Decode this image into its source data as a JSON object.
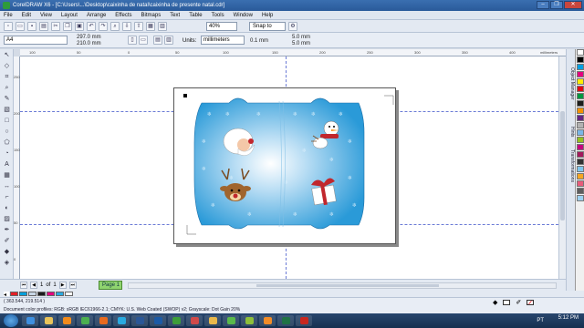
{
  "window": {
    "title": "CorelDRAW X6 - [C:\\Users\\...\\Desktop\\caixinha de natal\\caixinha de presente natal.cdr]",
    "controls": [
      "–",
      "❐",
      "✕"
    ]
  },
  "menu": [
    "File",
    "Edit",
    "View",
    "Layout",
    "Arrange",
    "Effects",
    "Bitmaps",
    "Text",
    "Table",
    "Tools",
    "Window",
    "Help"
  ],
  "toolbar": {
    "zoom": "40%",
    "snap_to": "Snap to"
  },
  "property_bar": {
    "paper": "A4",
    "width": "297.0 mm",
    "height": "210.0 mm",
    "units_label": "Units:",
    "units": "millimeters",
    "nudge": "0.1 mm",
    "dup_x": "5.0 mm",
    "dup_y": "5.0 mm"
  },
  "rulers": {
    "unit_label": "millimeters",
    "top_ticks": [
      "100",
      "50",
      "0",
      "50",
      "100",
      "150",
      "200",
      "250",
      "300",
      "350",
      "400"
    ],
    "left_ticks": [
      "250",
      "200",
      "150",
      "100",
      "50",
      "0"
    ]
  },
  "docker_tabs": [
    "Object Manager",
    "Hints",
    "Transformations"
  ],
  "palette_colors": [
    "#ffffff",
    "#000000",
    "#00a0e3",
    "#e4007f",
    "#ffed00",
    "#e30613",
    "#009640",
    "#1d1d1b",
    "#f39200",
    "#662483",
    "#b2b2b2",
    "#7ab6e6",
    "#95c11f",
    "#c6007e",
    "#a3195b",
    "#333333",
    "#7fc6ec",
    "#f6a623",
    "#e85c7a",
    "#5e5e5e",
    "#9ed2f2"
  ],
  "page_nav": {
    "current": "1",
    "of": "of",
    "total": "1",
    "tab": "Page 1"
  },
  "document_colors": [
    "#e41e26",
    "#00a0dc",
    "#c8d6e6",
    "#1c1c1c",
    "#e4007f",
    "#29aae1",
    "#ffffff"
  ],
  "status": {
    "coords": "( 363.544, 219.514 )",
    "profiles": "Document color profiles: RGB: sRGB IEC61966-2.1; CMYK: U.S. Web Coated (SWOP) v2; Grayscale: Dot Gain 20%",
    "fill_label": "None"
  },
  "taskbar": {
    "lang": "PT",
    "time": "5:12 PM",
    "apps": [
      {
        "name": "ie",
        "color": "#3d8fe0"
      },
      {
        "name": "explorer",
        "color": "#e8c35a"
      },
      {
        "name": "media",
        "color": "#f08a1c"
      },
      {
        "name": "chrome",
        "color": "#4caf50"
      },
      {
        "name": "firefox",
        "color": "#e86a1f"
      },
      {
        "name": "skype",
        "color": "#29aae1"
      },
      {
        "name": "word",
        "color": "#2b5797"
      },
      {
        "name": "photoshop",
        "color": "#1c5aa6"
      },
      {
        "name": "corel",
        "color": "#3c9e3a"
      },
      {
        "name": "paint",
        "color": "#d04a4a"
      },
      {
        "name": "folder",
        "color": "#e9b84b"
      },
      {
        "name": "msn",
        "color": "#5ab94b"
      },
      {
        "name": "utorrent",
        "color": "#8dbf3a"
      },
      {
        "name": "vlc",
        "color": "#f28c28"
      },
      {
        "name": "excel",
        "color": "#207245"
      },
      {
        "name": "acrobat",
        "color": "#c8261e"
      }
    ]
  }
}
